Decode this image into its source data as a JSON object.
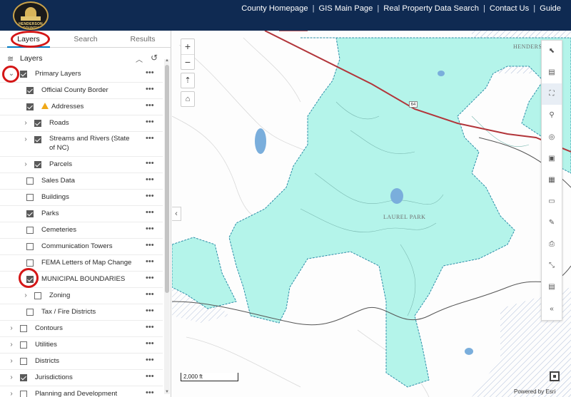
{
  "header": {
    "logo_text": "HENDERSON COUNTY",
    "nav": [
      "County Homepage",
      "GIS Main Page",
      "Real Property Data Search",
      "Contact Us",
      "Guide"
    ],
    "separator": "|"
  },
  "tabs": [
    {
      "label": "Layers",
      "active": true
    },
    {
      "label": "Search",
      "active": false
    },
    {
      "label": "Results",
      "active": false
    }
  ],
  "layers_panel": {
    "title": "Layers",
    "items": [
      {
        "label": "Primary Layers",
        "level": 0,
        "expandable": true,
        "expanded": true,
        "checked": true
      },
      {
        "label": "Official County Border",
        "level": 1,
        "expandable": false,
        "checked": true
      },
      {
        "label": "Addresses",
        "level": 1,
        "expandable": false,
        "checked": true,
        "warning": true
      },
      {
        "label": "Roads",
        "level": 1,
        "expandable": true,
        "checked": true
      },
      {
        "label": "Streams and Rivers (State of NC)",
        "level": 1,
        "expandable": true,
        "checked": true,
        "tall": true
      },
      {
        "label": "Parcels",
        "level": 1,
        "expandable": true,
        "checked": true
      },
      {
        "label": "Sales Data",
        "level": 1,
        "expandable": false,
        "checked": false
      },
      {
        "label": "Buildings",
        "level": 1,
        "expandable": false,
        "checked": false
      },
      {
        "label": "Parks",
        "level": 1,
        "expandable": false,
        "checked": true
      },
      {
        "label": "Cemeteries",
        "level": 1,
        "expandable": false,
        "checked": false
      },
      {
        "label": "Communication Towers",
        "level": 1,
        "expandable": false,
        "checked": false
      },
      {
        "label": "FEMA Letters of Map Change",
        "level": 1,
        "expandable": false,
        "checked": false
      },
      {
        "label": "MUNICIPAL BOUNDARIES",
        "level": 1,
        "expandable": false,
        "checked": true
      },
      {
        "label": "Zoning",
        "level": 1,
        "expandable": true,
        "checked": false
      },
      {
        "label": "Tax / Fire Districts",
        "level": 1,
        "expandable": false,
        "checked": false
      },
      {
        "label": "Contours",
        "level": 0,
        "expandable": true,
        "checked": false
      },
      {
        "label": "Utilities",
        "level": 0,
        "expandable": true,
        "checked": false
      },
      {
        "label": "Districts",
        "level": 0,
        "expandable": true,
        "checked": false
      },
      {
        "label": "Jurisdictions",
        "level": 0,
        "expandable": true,
        "checked": true
      },
      {
        "label": "Planning and Development",
        "level": 0,
        "expandable": true,
        "checked": false
      }
    ],
    "more_glyph": "•••"
  },
  "map": {
    "labels": {
      "laurel_park": "LAUREL PARK",
      "henderson": "HENDERS",
      "route": "64"
    },
    "scale_label": "2,000 ft",
    "attribution": "Powered by Esri",
    "municipal_fill": "#b4f4ea",
    "municipal_line": "#2d8fa8",
    "road_color": "#b2353a"
  },
  "toolbar_icons": [
    "select-icon",
    "basemap-icon",
    "extent-icon",
    "location-pin-icon",
    "compass-icon",
    "save-map-icon",
    "print-layout-icon",
    "measure-icon",
    "draw-icon",
    "print-icon",
    "fullscreen-icon",
    "export-icon",
    "collapse-icon"
  ]
}
